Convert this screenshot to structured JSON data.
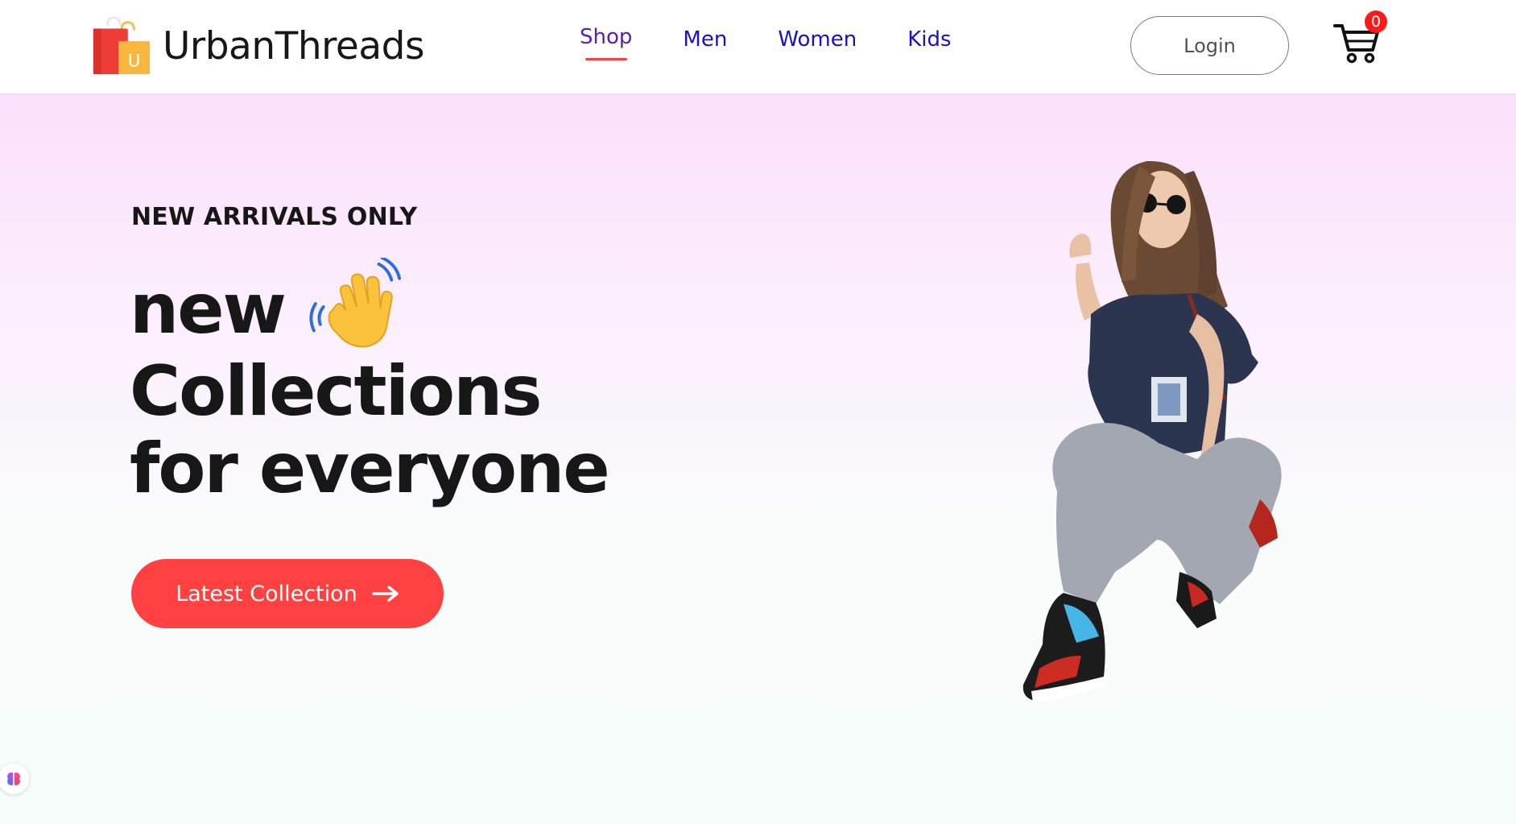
{
  "brand": {
    "name": "UrbanThreads",
    "logo_badge_letter": "U",
    "logo_icon": "shopping-bag-icon"
  },
  "nav": {
    "items": [
      {
        "label": "Shop",
        "active": true
      },
      {
        "label": "Men",
        "active": false
      },
      {
        "label": "Women",
        "active": false
      },
      {
        "label": "Kids",
        "active": false
      }
    ]
  },
  "header": {
    "login_label": "Login",
    "cart_icon": "shopping-cart-icon",
    "cart_count": "0"
  },
  "hero": {
    "eyebrow": "NEW ARRIVALS ONLY",
    "title_line1": "new",
    "title_line2": "Collections",
    "title_line3": "for everyone",
    "wave_icon": "waving-hand-icon",
    "cta_label": "Latest Collection",
    "cta_icon": "arrow-right-icon",
    "image": "model-photo"
  },
  "widget": {
    "icon": "brain-icon"
  },
  "colors": {
    "accent": "#ff4141",
    "nav_link": "#1a10c9",
    "nav_active": "#5b1fb0",
    "text_dark": "#171717",
    "hero_gradient_top": "#fbe0fb",
    "hero_gradient_bottom": "#f6fdfa"
  }
}
